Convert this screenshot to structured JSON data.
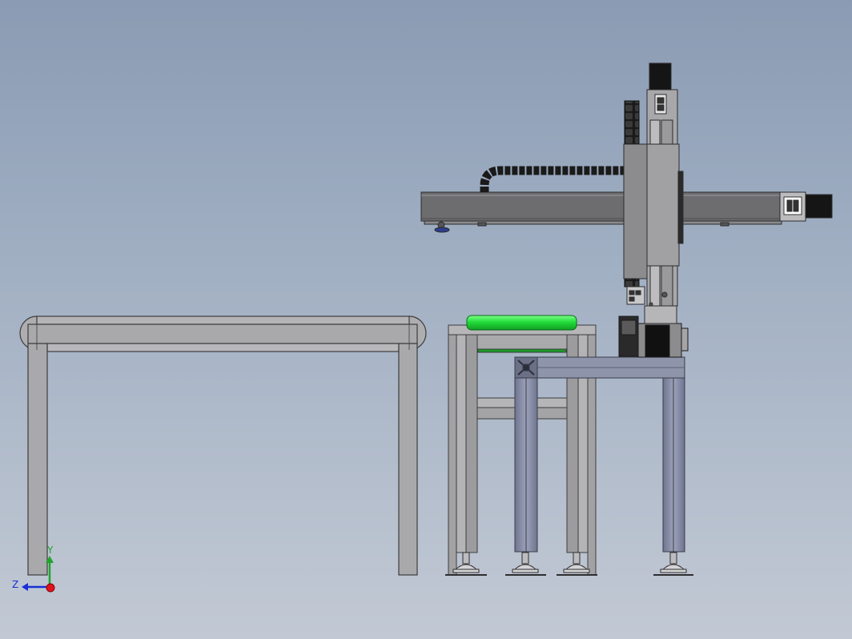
{
  "viewport": {
    "background_top": "#8a9bb3",
    "background_bottom": "#c2c9d4"
  },
  "triad": {
    "y_label": "Y",
    "z_label": "Z",
    "x_color": "#e0141e",
    "y_color": "#1fa52a",
    "z_color": "#1a2fd6"
  },
  "colors": {
    "frame_gray": "#a9a9ab",
    "frame_edge": "#3c3c3e",
    "profile_blue": "#8a90a6",
    "beam_dark": "#6d6d6f",
    "carriage": "#8c8c8e",
    "part_green": "#22dd3a",
    "black": "#111111"
  },
  "icons": [
    "triad-icon"
  ]
}
